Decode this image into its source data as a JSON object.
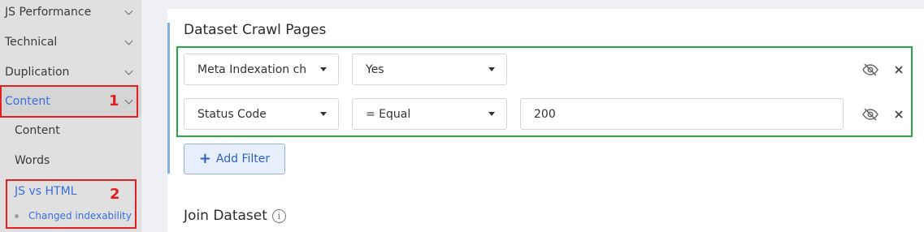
{
  "sidebar": {
    "items": [
      {
        "label": "JS Performance"
      },
      {
        "label": "Technical"
      },
      {
        "label": "Duplication"
      },
      {
        "label": "Content"
      }
    ],
    "sub_items": [
      {
        "label": "Content"
      },
      {
        "label": "Words"
      },
      {
        "label": "JS vs HTML"
      }
    ],
    "sub_sub_item": {
      "label": "Changed indexability"
    },
    "annotations": {
      "one": "1",
      "two": "2"
    }
  },
  "main": {
    "section_title": "Dataset Crawl Pages",
    "filters": [
      {
        "field": "Meta Indexation change",
        "operator": "Yes",
        "value": ""
      },
      {
        "field": "Status Code",
        "operator": "= Equal",
        "value": "200"
      }
    ],
    "add_filter_label": "Add Filter",
    "add_filter_icon": "+",
    "join_title": "Join Dataset",
    "info_icon_glyph": "i"
  },
  "colors": {
    "accent_blue": "#3b6fe0",
    "highlight_red": "#e02020",
    "highlight_green": "#27a844"
  }
}
